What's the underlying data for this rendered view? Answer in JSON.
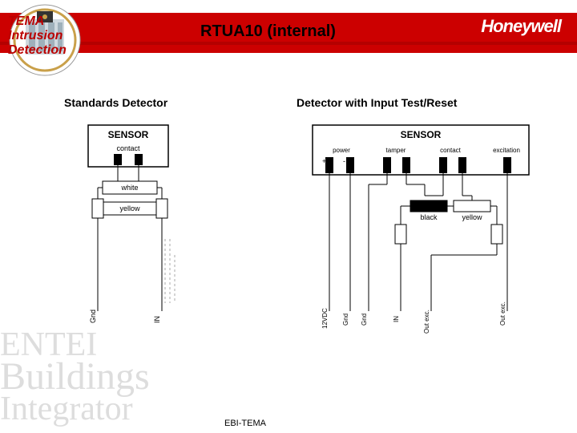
{
  "brand": "Honeywell",
  "badge": {
    "line1": "TEMA",
    "line2": "Intrusion",
    "line3": "Detection"
  },
  "title": "RTUA10 (internal)",
  "left_subtitle": "Standards Detector",
  "right_subtitle": "Detector with Input Test/Reset",
  "footer": "EBI-TEMA",
  "watermark": {
    "line1": "ENTEI",
    "line2": "Buildings",
    "line3": "Integrator"
  },
  "left_diagram": {
    "sensor_label": "SENSOR",
    "terminals": [
      "contact"
    ],
    "wires": [
      "white",
      "yellow"
    ],
    "bottom_labels": [
      "Gnd",
      "IN"
    ]
  },
  "right_diagram": {
    "sensor_label": "SENSOR",
    "terminals": [
      "power",
      "tamper",
      "contact",
      "excitation"
    ],
    "wires": [
      "black",
      "yellow"
    ],
    "bottom_labels": [
      "12VDC",
      "Gnd",
      "Gnd",
      "IN",
      "Out exc."
    ]
  }
}
